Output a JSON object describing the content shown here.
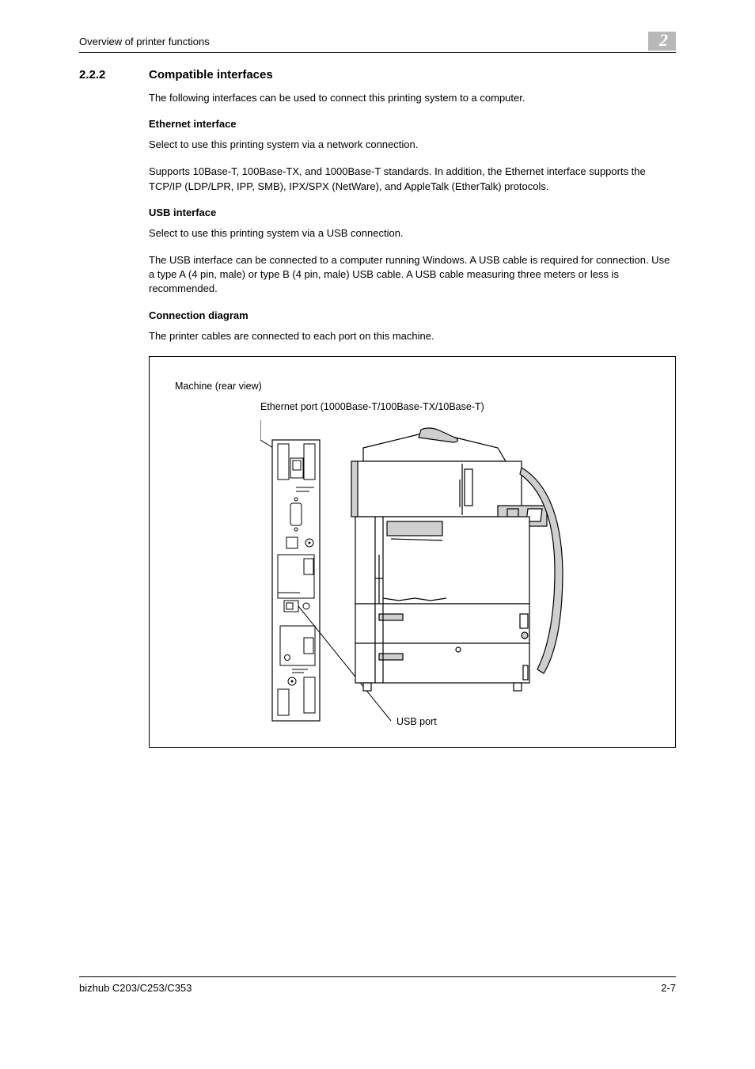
{
  "header": {
    "title": "Overview of printer functions",
    "chapter": "2"
  },
  "section": {
    "number": "2.2.2",
    "title": "Compatible interfaces",
    "intro": "The following interfaces can be used to connect this printing system to a computer."
  },
  "ethernet": {
    "heading": "Ethernet interface",
    "p1": "Select to use this printing system via a network connection.",
    "p2": "Supports 10Base-T, 100Base-TX, and 1000Base-T standards. In addition, the Ethernet interface supports the TCP/IP (LDP/LPR, IPP, SMB), IPX/SPX (NetWare), and AppleTalk (EtherTalk) protocols."
  },
  "usb": {
    "heading": "USB interface",
    "p1": "Select to use this printing system via a USB connection.",
    "p2": "The USB interface can be connected to a computer running Windows. A USB cable is required for connection. Use a type A (4 pin, male) or type B (4 pin, male) USB cable. A USB cable measuring three meters or less is recommended."
  },
  "diagram": {
    "heading": "Connection diagram",
    "intro": "The printer cables are connected to each port on this machine.",
    "machine_label": "Machine (rear view)",
    "ethernet_label": "Ethernet port (1000Base-T/100Base-TX/10Base-T)",
    "usb_label": "USB port"
  },
  "footer": {
    "model": "bizhub C203/C253/C353",
    "page": "2-7"
  }
}
